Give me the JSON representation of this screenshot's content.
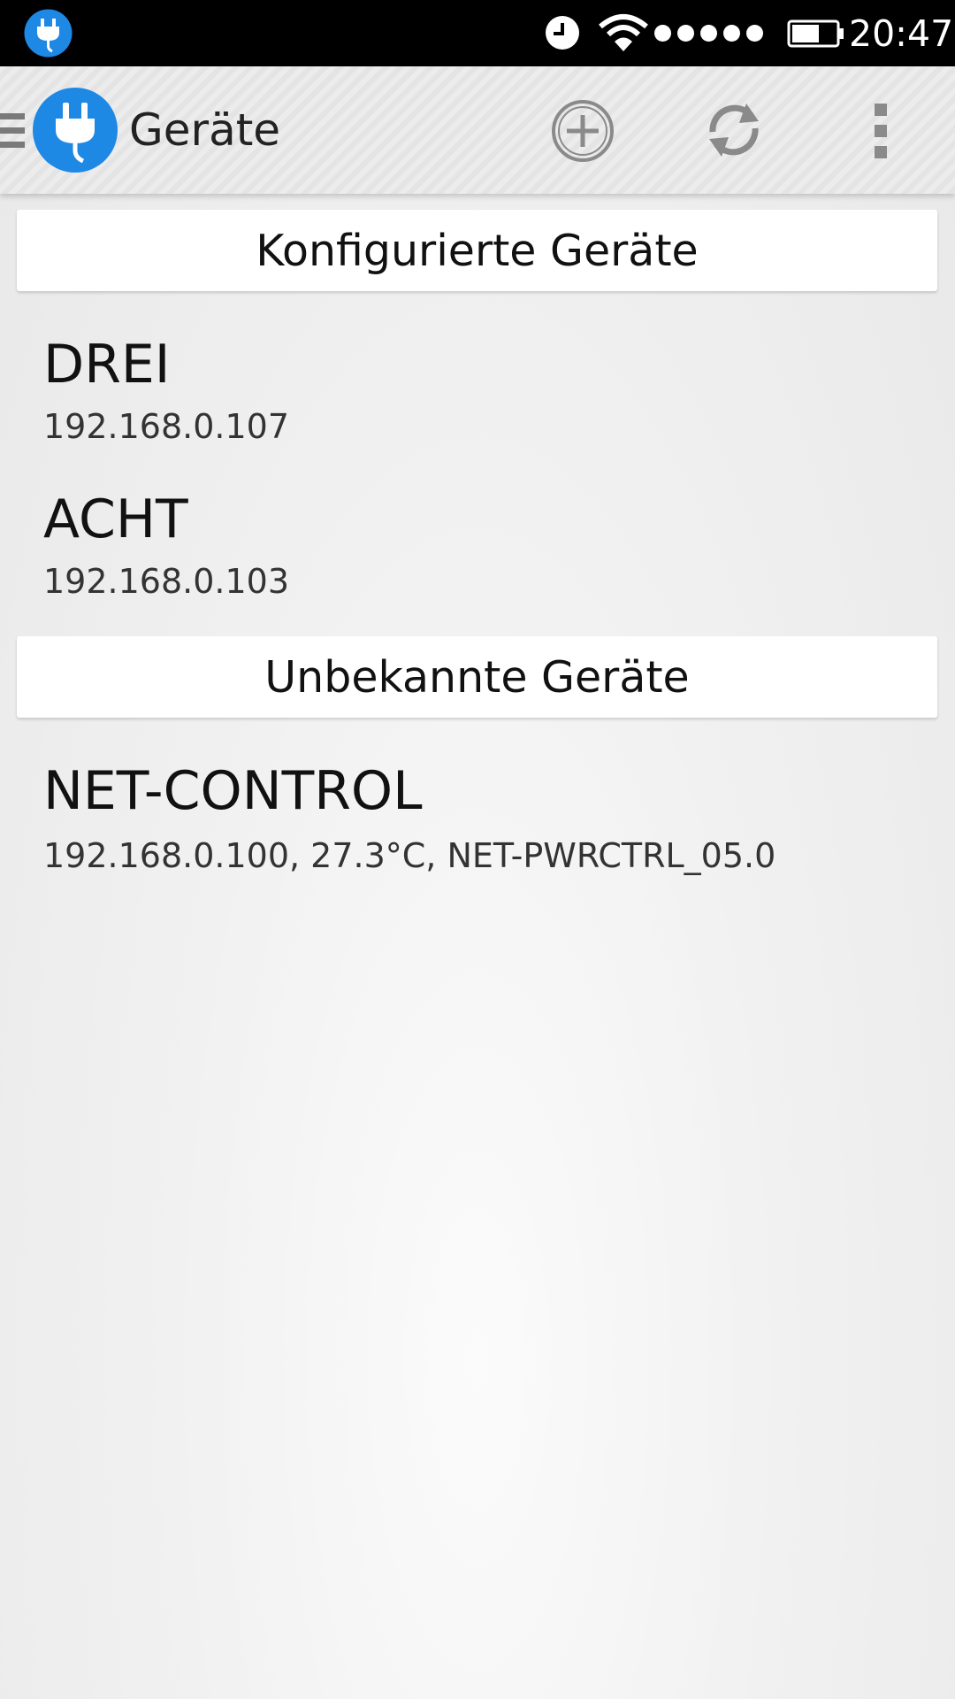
{
  "status_bar": {
    "time": "20:47",
    "icons": [
      "app-plug-icon",
      "alarm-icon",
      "wifi-icon",
      "signal-dots-icon",
      "battery-icon"
    ]
  },
  "action_bar": {
    "title": "Geräte",
    "icons": [
      "drawer-indicator-icon",
      "plug-logo-icon",
      "add-circle-icon",
      "refresh-icon",
      "overflow-menu-icon"
    ]
  },
  "sections": {
    "configured": {
      "header": "Konfigurierte Geräte",
      "devices": [
        {
          "name": "DREI",
          "detail": "192.168.0.107"
        },
        {
          "name": "ACHT",
          "detail": "192.168.0.103"
        }
      ]
    },
    "unknown": {
      "header": "Unbekannte Geräte",
      "devices": [
        {
          "name": "NET-CONTROL",
          "detail": "192.168.0.100, 27.3°C, NET-PWRCTRL_05.0"
        }
      ]
    }
  },
  "colors": {
    "accent": "#1e88e5",
    "status_bar": "#000000",
    "action_bar": "#e8e8e8"
  }
}
